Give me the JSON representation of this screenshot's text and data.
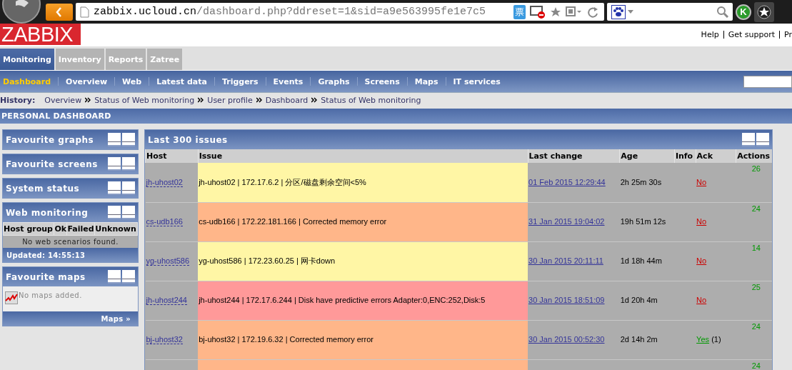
{
  "browser": {
    "url_host": "zabbix.ucloud.cn",
    "url_path": "/dashboard.php?ddreset=1&sid=a9e563995fe1e7c5",
    "ticket_badge": "票",
    "profile_badge": "K"
  },
  "header": {
    "logo": "ZABBIX",
    "links": [
      "Help",
      "Get support",
      "Pr"
    ]
  },
  "main_menu": [
    {
      "label": "Monitoring",
      "selected": true
    },
    {
      "label": "Inventory",
      "selected": false
    },
    {
      "label": "Reports",
      "selected": false
    },
    {
      "label": "Zatree",
      "selected": false
    }
  ],
  "sub_menu": [
    {
      "label": "Dashboard",
      "selected": true
    },
    {
      "label": "Overview",
      "selected": false
    },
    {
      "label": "Web",
      "selected": false
    },
    {
      "label": "Latest data",
      "selected": false
    },
    {
      "label": "Triggers",
      "selected": false
    },
    {
      "label": "Events",
      "selected": false
    },
    {
      "label": "Graphs",
      "selected": false
    },
    {
      "label": "Screens",
      "selected": false
    },
    {
      "label": "Maps",
      "selected": false
    },
    {
      "label": "IT services",
      "selected": false
    }
  ],
  "history": {
    "label": "History:",
    "items": [
      "Overview",
      "Status of Web monitoring",
      "User profile",
      "Dashboard",
      "Status of Web monitoring"
    ]
  },
  "page_title": "PERSONAL DASHBOARD",
  "left_widgets": [
    {
      "kind": "collapsed",
      "title": "Favourite graphs"
    },
    {
      "kind": "collapsed",
      "title": "Favourite screens"
    },
    {
      "kind": "collapsed",
      "title": "System status"
    },
    {
      "kind": "web",
      "title": "Web monitoring",
      "columns": [
        "Host group",
        "Ok",
        "Failed",
        "Unknown"
      ],
      "message": "No web scenarios found.",
      "footer": "Updated: 14:55:13"
    },
    {
      "kind": "maps",
      "title": "Favourite maps",
      "message": "No maps added.",
      "footer": "Maps »"
    }
  ],
  "issues": {
    "title": "Last 300 issues",
    "columns": [
      "Host",
      "Issue",
      "Last change",
      "Age",
      "Info",
      "Ack",
      "Actions"
    ],
    "rows": [
      {
        "host": "jh-uhost02",
        "issue": "jh-uhost02 | 172.17.6.2 | 分区/磁盘剩余空间<5%",
        "color": "#fff6a5",
        "last_change": "01 Feb 2015 12:29:44",
        "age": "2h 25m 30s",
        "ack": {
          "label": "No",
          "acknowledged": false
        },
        "actions": "26"
      },
      {
        "host": "cs-udb166",
        "issue": "cs-udb166 | 172.22.181.166 | Corrected memory error",
        "color": "#ffb689",
        "last_change": "31 Jan 2015 19:04:02",
        "age": "19h 51m 12s",
        "ack": {
          "label": "No",
          "acknowledged": false
        },
        "actions": "24"
      },
      {
        "host": "yg-uhost586",
        "issue": "yg-uhost586 | 172.23.60.25 | 网卡down",
        "color": "#fff6a5",
        "last_change": "30 Jan 2015 20:11:11",
        "age": "1d 18h 44m",
        "ack": {
          "label": "No",
          "acknowledged": false
        },
        "actions": "14"
      },
      {
        "host": "jh-uhost244",
        "issue": "jh-uhost244 | 172.17.6.244 | Disk have predictive errors Adapter:0,ENC:252,Disk:5",
        "color": "#ff9999",
        "last_change": "30 Jan 2015 18:51:09",
        "age": "1d 20h 4m",
        "ack": {
          "label": "No",
          "acknowledged": false
        },
        "actions": "25"
      },
      {
        "host": "bj-uhost32",
        "issue": "bj-uhost32 | 172.19.6.32 | Corrected memory error",
        "color": "#ffb689",
        "last_change": "30 Jan 2015 00:52:30",
        "age": "2d 14h 2m",
        "ack": {
          "label": "Yes",
          "acknowledged": true
        },
        "ack_count": "(1)",
        "actions": "24"
      },
      {
        "color": "#ffb689",
        "actions": "24"
      }
    ]
  }
}
